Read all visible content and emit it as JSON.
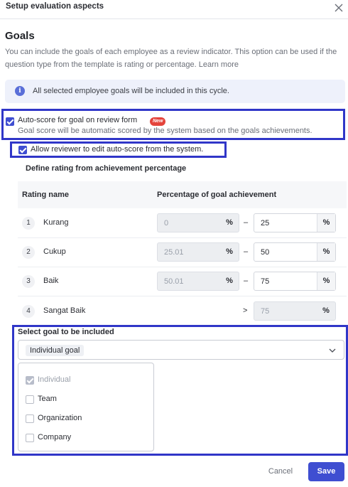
{
  "header": {
    "title": "Setup evaluation aspects"
  },
  "goals": {
    "title": "Goals",
    "description": "You can include the goals of each employee as a review indicator. This option can be used if the question type from the template is rating or percentage.",
    "learn_more": "Learn more"
  },
  "info": {
    "icon": "info-icon",
    "text": "All selected employee goals will be included in this cycle."
  },
  "auto_score": {
    "label": "Auto-score for goal on review form",
    "badge": "New",
    "sublabel": "Goal score will be automatic scored by the system based on the goals achievements.",
    "checked": true
  },
  "allow_edit": {
    "label": "Allow reviewer to edit auto-score from the system.",
    "checked": true
  },
  "rating": {
    "section_label": "Define rating from achievement percentage",
    "col_name": "Rating name",
    "col_pct": "Percentage of goal achievement",
    "rows": [
      {
        "num": "1",
        "name": "Kurang",
        "from": "0",
        "from_unit": "%",
        "sep": "–",
        "to": "25",
        "to_unit": "%"
      },
      {
        "num": "2",
        "name": "Cukup",
        "from": "25.01",
        "from_unit": "%",
        "sep": "–",
        "to": "50",
        "to_unit": "%"
      },
      {
        "num": "3",
        "name": "Baik",
        "from": "50.01",
        "from_unit": "%",
        "sep": "–",
        "to": "75",
        "to_unit": "%"
      },
      {
        "num": "4",
        "name": "Sangat Baik",
        "sep": ">",
        "to": "75",
        "to_unit": "%"
      }
    ]
  },
  "goal_select": {
    "label": "Select goal to be included",
    "selected_chip": "Individual goal",
    "options": [
      {
        "label": "Individual",
        "checked": true,
        "disabled": true
      },
      {
        "label": "Team",
        "checked": false,
        "disabled": false
      },
      {
        "label": "Organization",
        "checked": false,
        "disabled": false
      },
      {
        "label": "Company",
        "checked": false,
        "disabled": false
      }
    ]
  },
  "footer": {
    "cancel": "Cancel",
    "save": "Save"
  },
  "colors": {
    "accent": "#3f4ed1",
    "highlight": "#3036c8",
    "badge": "#e4443c"
  }
}
